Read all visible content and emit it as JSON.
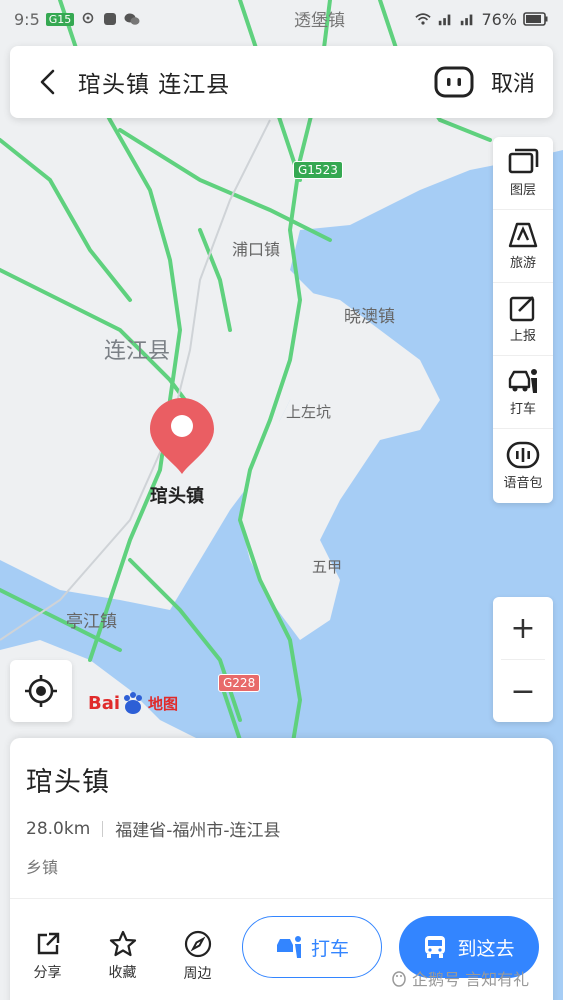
{
  "status_bar": {
    "time": "9:5",
    "carrier_badge": "G15",
    "place_label": "透堡镇",
    "battery": "76%"
  },
  "search": {
    "query": "琯头镇 连江县",
    "cancel_label": "取消"
  },
  "tools": [
    {
      "label": "图层",
      "icon": "layers-icon"
    },
    {
      "label": "旅游",
      "icon": "travel-icon"
    },
    {
      "label": "上报",
      "icon": "report-icon"
    },
    {
      "label": "打车",
      "icon": "taxi-icon"
    },
    {
      "label": "语音包",
      "icon": "voice-pack-icon"
    }
  ],
  "zoom": {
    "in": "+",
    "out": "−"
  },
  "map": {
    "labels": {
      "pukou": "浦口镇",
      "xiaoao": "晓澳镇",
      "lianjiang": "连江县",
      "shangzuokeng": "上左坑",
      "guantou": "琯头镇",
      "wujia": "五甲",
      "tingjiang": "亭江镇"
    },
    "roads": {
      "g1523": "G1523",
      "g228": "G228"
    },
    "colors": {
      "land": "#eef0f2",
      "water": "#a6cdf5",
      "road": "#5fd17e",
      "badge": "#35a852",
      "badge_national": "#e86a6a"
    }
  },
  "logo": {
    "bai": "Bai",
    "ditu": "地图"
  },
  "place": {
    "name": "琯头镇",
    "distance": "28.0km",
    "address": "福建省-福州市-连江县",
    "category": "乡镇"
  },
  "actions": {
    "share": "分享",
    "favorite": "收藏",
    "nearby": "周边",
    "taxi": "打车",
    "go_here": "到这去"
  },
  "watermark": "企鹅号 言知有礼"
}
